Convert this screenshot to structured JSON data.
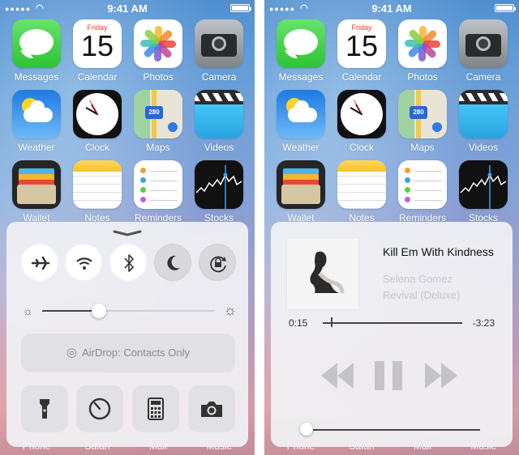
{
  "status": {
    "time": "9:41 AM"
  },
  "apps": [
    {
      "label": "Messages"
    },
    {
      "label": "Calendar"
    },
    {
      "label": "Photos"
    },
    {
      "label": "Camera"
    },
    {
      "label": "Weather"
    },
    {
      "label": "Clock"
    },
    {
      "label": "Maps"
    },
    {
      "label": "Videos"
    },
    {
      "label": "Wallet"
    },
    {
      "label": "Notes"
    },
    {
      "label": "Reminders"
    },
    {
      "label": "Stocks"
    }
  ],
  "calendar_icon": {
    "day": "Friday",
    "date": "15"
  },
  "maps_icon": {
    "shield": "280"
  },
  "dock": {
    "apps": [
      "Phone",
      "Safari",
      "Mail",
      "Music"
    ]
  },
  "control_center": {
    "toggles": [
      {
        "icon": "airplane-icon",
        "state": "off"
      },
      {
        "icon": "wifi-icon",
        "state": "off"
      },
      {
        "icon": "bluetooth-icon",
        "state": "off"
      },
      {
        "icon": "moon-icon",
        "state": "off"
      },
      {
        "icon": "rotation-lock-icon",
        "state": "off"
      }
    ],
    "brightness": 0.33,
    "airdrop_label": "AirDrop: Contacts Only",
    "shortcuts": [
      "flashlight-icon",
      "timer-icon",
      "calculator-icon",
      "camera-icon"
    ]
  },
  "now_playing": {
    "title": "Kill Em With Kindness",
    "artist": "Selena Gomez",
    "album": "Revival (Deluxe)",
    "elapsed": "0:15",
    "remaining": "-3:23",
    "progress": 0.06,
    "volume": 0.0
  },
  "colors": {
    "accent_green": "#2ec235",
    "calendar_red": "#f23a2f"
  }
}
